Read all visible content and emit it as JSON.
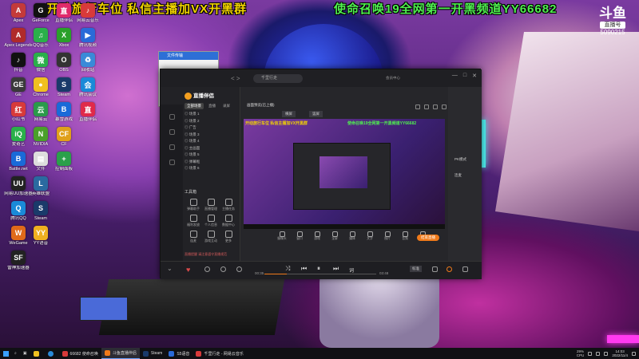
{
  "stream_overlay": {
    "left_text": "开动旅行车位 私信主播加VX开黑群",
    "right_text": "使命召唤19全网第一开黑频道YY66682"
  },
  "douyu": {
    "logo": "斗鱼",
    "tag": "直播号",
    "room_id": "5090215"
  },
  "desktop_icons": [
    {
      "label": "Apex",
      "color": "#c43a3a",
      "glyph": "A"
    },
    {
      "label": "Apex Legends",
      "color": "#b02a2a",
      "glyph": "A"
    },
    {
      "label": "抖音",
      "color": "#111111",
      "glyph": "♪"
    },
    {
      "label": "GE",
      "color": "#3a3a3a",
      "glyph": "GE"
    },
    {
      "label": "小红书",
      "color": "#d83a3a",
      "glyph": "红"
    },
    {
      "label": "爱奇艺",
      "color": "#2ab04a",
      "glyph": "iQ"
    },
    {
      "label": "Battle.net",
      "color": "#1a6ad8",
      "glyph": "B"
    },
    {
      "label": "网易UU加速器",
      "color": "#222222",
      "glyph": "UU"
    },
    {
      "label": "腾讯QQ",
      "color": "#1a8ad8",
      "glyph": "Q"
    },
    {
      "label": "WeGame",
      "color": "#e06a1a",
      "glyph": "W"
    },
    {
      "label": "雷神加速器",
      "color": "#222222",
      "glyph": "SF"
    },
    {
      "label": "GeForce",
      "color": "#111111",
      "glyph": "G"
    },
    {
      "label": "QQ音乐",
      "color": "#2ab04a",
      "glyph": "♫"
    },
    {
      "label": "微信",
      "color": "#2ab04a",
      "glyph": "微"
    },
    {
      "label": "Chrome",
      "color": "#f0c020",
      "glyph": "●"
    },
    {
      "label": "网易云",
      "color": "#2a9a4a",
      "glyph": "云"
    },
    {
      "label": "NVIDIA",
      "color": "#4aa02a",
      "glyph": "N"
    },
    {
      "label": "文件",
      "color": "#dddddd",
      "glyph": "▤"
    },
    {
      "label": "英雄联盟",
      "color": "#2a6aa0",
      "glyph": "L"
    },
    {
      "label": "Steam",
      "color": "#1a3a6a",
      "glyph": "S"
    },
    {
      "label": "YY语音",
      "color": "#f0b020",
      "glyph": "YY"
    },
    {
      "label": "直播伴侣",
      "color": "#e02a6a",
      "glyph": "直"
    },
    {
      "label": "Xbox",
      "color": "#2aa02a",
      "glyph": "X"
    },
    {
      "label": "OBS",
      "color": "#333333",
      "glyph": "O"
    },
    {
      "label": "Steam",
      "color": "#1a3a6a",
      "glyph": "S"
    },
    {
      "label": "暴雪游戏",
      "color": "#1a6ad8",
      "glyph": "B"
    },
    {
      "label": "CF",
      "color": "#e0a01a",
      "glyph": "CF"
    },
    {
      "label": "控制面板",
      "color": "#2aa04a",
      "glyph": "+"
    },
    {
      "label": "网易云音乐",
      "color": "#d83a3a",
      "glyph": "♪"
    },
    {
      "label": "腾讯视频",
      "color": "#2a6ad8",
      "glyph": "▶"
    },
    {
      "label": "回收站",
      "color": "#3a8ad8",
      "glyph": "♻"
    },
    {
      "label": "腾讯会议",
      "color": "#1a8ad8",
      "glyph": "会"
    },
    {
      "label": "直播伴侣",
      "color": "#e02a4a",
      "glyph": "直"
    }
  ],
  "mini_window": {
    "title": "文件传输"
  },
  "app": {
    "nav_arrows": "< >",
    "search_placeholder": "千里行走",
    "title_small": "会员中心",
    "window_controls": [
      "—",
      "□",
      "✕"
    ],
    "logo_text": "直播伴侣",
    "logo_badge": "斗鱼",
    "tabs": [
      "全部场景",
      "直播",
      "录屏"
    ],
    "scenes": [
      "◎ 场景 1",
      "◎ 场景 2",
      "◎ 广告",
      "◎ 场景 3",
      "◎ 场景 4",
      "◎ 主画面",
      "◎ 场景 5",
      "◎ 弹幕框",
      "◎ 场景 6"
    ],
    "tools_title": "工具箱",
    "tools": [
      "弹幕助手",
      "直播管理",
      "主播任务",
      "福利发放",
      "个人信息",
      "数据中心",
      "连麦",
      "游戏互动",
      "更多"
    ],
    "notice": "直播提醒 请注意遵守直播规范",
    "preview_title": "画面预览(已上播)",
    "preview_tabs": [
      "横屏",
      "竖屏"
    ],
    "preview_overlay_l": "开动旅行车位 私信主播加VX开黑群",
    "preview_overlay_r": "使命召唤19全网第一开黑频道YY66682",
    "preview_tools": [
      "摄像头",
      "窗口",
      "游戏",
      "全屏",
      "媒体",
      "文字",
      "图片",
      "音频",
      "特效"
    ],
    "live_button": "结束直播",
    "right_panel": [
      "PK模式",
      "连麦"
    ],
    "player_time_start": "00:35",
    "player_time_end": "03:48",
    "player_progress": 0.2,
    "player_tag": "标准"
  },
  "taskbar": {
    "items": [
      {
        "label": "66682 使命召唤",
        "color": "#d83a3a",
        "active": false
      },
      {
        "label": "斗鱼直播伴侣",
        "color": "#f07a1a",
        "active": true
      },
      {
        "label": "Steam",
        "color": "#1a3a6a",
        "active": false
      },
      {
        "label": "S5语音",
        "color": "#2a6ad8",
        "active": false
      },
      {
        "label": "千里行走 - 网易云音乐",
        "color": "#d83a3a",
        "active": false
      }
    ],
    "cpu": "29%",
    "cpu_label": "CPU",
    "time": "14:03",
    "date": "2022/11/4"
  }
}
